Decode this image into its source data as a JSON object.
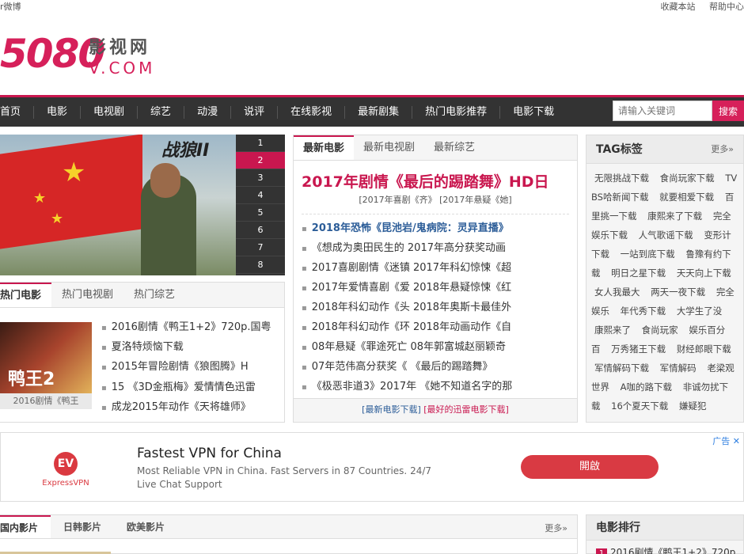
{
  "topbar": {
    "left": "r微博",
    "right": [
      "收藏本站",
      "帮助中心"
    ]
  },
  "logo": {
    "big": "5080",
    "cn": "影视网",
    "vcom": "V.COM"
  },
  "nav": {
    "items": [
      "首页",
      "电影",
      "电视剧",
      "综艺",
      "动漫",
      "说评",
      "在线影视",
      "最新剧集",
      "热门电影推荐",
      "电影下载"
    ],
    "search_placeholder": "请输入关键词",
    "search_button": "搜索"
  },
  "slider": {
    "poster_title": "战狼II",
    "numbers": [
      "1",
      "2",
      "3",
      "4",
      "5",
      "6",
      "7",
      "8"
    ],
    "active_index": 2
  },
  "hot": {
    "tabs": [
      "热门电影",
      "热门电视剧",
      "热门综艺"
    ],
    "thumb_title": "鸭王2",
    "thumb_caption": "2016剧情《鸭王",
    "items": [
      "2016剧情《鸭王1+2》720p.国粤",
      "夏洛特烦恼下载",
      "2015年冒险剧情《狼图腾》H",
      "15 《3D金瓶梅》爱情情色迅雷",
      "成龙2015年动作《天将雄师》"
    ]
  },
  "latest": {
    "tabs": [
      "最新电影",
      "最新电视剧",
      "最新综艺"
    ],
    "headline": "2017年剧情《最后的踢踏舞》HD日",
    "subline": "[2017年喜剧《齐》  [2017年悬疑《她]",
    "items": [
      "2018年恐怖《昆池岩/鬼病院：灵异直播》",
      "《想成为奥田民生的   2017年高分获奖动画",
      "2017喜剧剧情《迷镇   2017年科幻惊悚《超",
      "2017年爱情喜剧《爱   2018年悬疑惊悚《红",
      "2018年科幻动作《头   2018年奥斯卡最佳外",
      "2018年科幻动作《环   2018年动画动作《自",
      "08年悬疑《罪途死亡   08年郭富城赵丽颖奇",
      "07年范伟高分获奖《   《最后的踢踏舞》",
      "《极恶非道3》2017年   《她不知道名字的那"
    ],
    "foot_a": "[最新电影下载]",
    "foot_b": "[最好的迅雷电影下载]"
  },
  "tags": {
    "title": "TAG标签",
    "more": "更多»",
    "items": [
      "无限挑战下载",
      "食尚玩家下载",
      "TVBS哈新闻下载",
      "就要相爱下载",
      "百里挑一下载",
      "康熙来了下载",
      "完全娱乐下载",
      "人气歌谣下载",
      "变形计下载",
      "一站到底下载",
      "鲁豫有约下载",
      "明日之星下载",
      "天天向上下载",
      "女人我最大",
      "两天一夜下载",
      "完全娱乐",
      "年代秀下载",
      "大学生了没",
      "康熙来了",
      "食尚玩家",
      "娱乐百分百",
      "万秀猪王下载",
      "财经郎眼下载",
      "军情解码下载",
      "军情解码",
      "老梁观世界",
      "A咖的路下载",
      "非诚勿扰下载",
      "16个夏天下载",
      "嫌疑犯"
    ]
  },
  "ad": {
    "brand": "ExpressVPN",
    "title": "Fastest VPN for China",
    "desc": "Most Reliable VPN in China. Fast Servers in 87 Countries. 24/7 Live Chat Support",
    "button": "開啟",
    "tag": "广告 ✕"
  },
  "region": {
    "tabs": [
      "国内影片",
      "日韩影片",
      "欧美影片"
    ],
    "more": "更多»"
  },
  "rank": {
    "title": "电影排行",
    "first_num": "1",
    "first": "2016剧情《鸭王1+2》720p"
  }
}
